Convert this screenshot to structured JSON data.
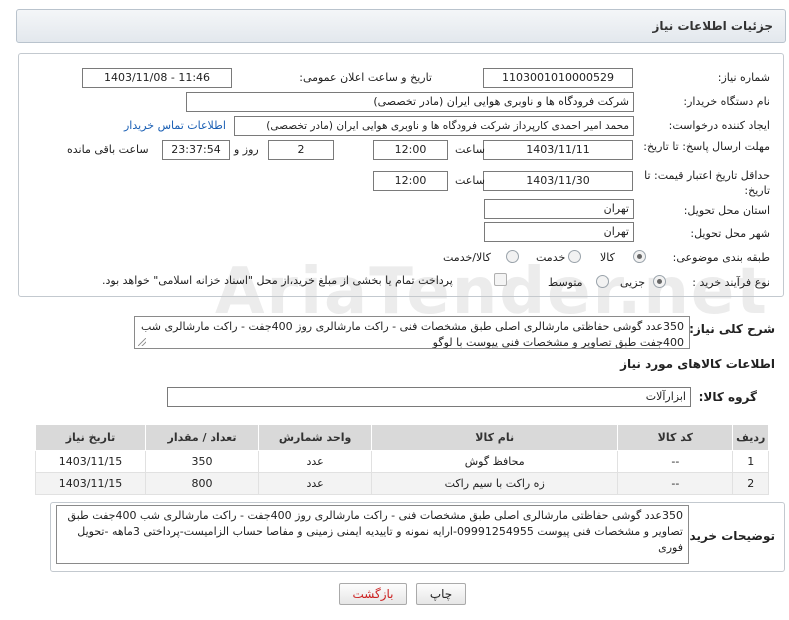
{
  "header": {
    "title": "جزئیات اطلاعات نیاز"
  },
  "fields": {
    "need_number_label": "شماره نیاز:",
    "need_number": "1103001010000529",
    "announce_label": "تاریخ و ساعت اعلان عمومی:",
    "announce_value": "1403/11/08 - 11:46",
    "buyer_org_label": "نام دستگاه خریدار:",
    "buyer_org": "شرکت فرودگاه ها و ناوبری هوایی ایران (مادر تخصصی)",
    "creator_label": "ایجاد کننده درخواست:",
    "creator": "محمد امیر احمدی کارپرداز شرکت فرودگاه ها و ناوبری هوایی ایران (مادر تخصصی)",
    "contact_link": "اطلاعات تماس خریدار",
    "deadline_label": "مهلت ارسال پاسخ: تا تاریخ:",
    "deadline_date": "1403/11/11",
    "time_word": "ساعت",
    "deadline_time": "12:00",
    "days_value": "2",
    "days_word": "روز و",
    "remaining_time": "23:37:54",
    "remaining_word": "ساعت باقی مانده",
    "validity_label": "حداقل تاریخ اعتبار قیمت: تا تاریخ:",
    "validity_date": "1403/11/30",
    "validity_time": "12:00",
    "province_label": "استان محل تحویل:",
    "province": "تهران",
    "city_label": "شهر محل تحویل:",
    "city": "تهران",
    "category_label": "طبقه بندی موضوعی:",
    "category_options": [
      "کالا",
      "خدمت",
      "کالا/خدمت"
    ],
    "process_label": "نوع فرآیند خرید :",
    "process_options": [
      "جزیی",
      "متوسط"
    ],
    "payment_note": "پرداخت تمام یا بخشی از مبلغ خرید،از محل \"اسناد خزانه اسلامی\" خواهد بود."
  },
  "description": {
    "label": "شرح کلی نیاز:",
    "text": "350عدد گوشی حفاظتی مارشالری اصلی طبق مشخصات فنی - راکت مارشالری روز 400جفت - راکت مارشالری شب 400جفت طبق تصاویر و مشخصات فنی پیوست با لوگو"
  },
  "goods_section": {
    "title": "اطلاعات کالاهای مورد نیاز",
    "group_label": "گروه کالا:",
    "group_value": "ابزارآلات"
  },
  "table": {
    "headers": [
      "ردیف",
      "کد کالا",
      "نام کالا",
      "واحد شمارش",
      "تعداد / مقدار",
      "تاریخ نیاز"
    ],
    "rows": [
      [
        "1",
        "--",
        "محافظ گوش",
        "عدد",
        "350",
        "1403/11/15"
      ],
      [
        "2",
        "--",
        "زه راکت با سیم راکت",
        "عدد",
        "800",
        "1403/11/15"
      ]
    ]
  },
  "buyer_notes": {
    "label": "توضیحات خریدار:",
    "text": "350عدد گوشی حفاظتی مارشالری اصلی طبق مشخصات فنی - راکت مارشالری روز 400جفت - راکت مارشالری شب 400جفت طبق تصاویر و مشخصات فنی پیوست 09991254955-ارایه نمونه و تاییدیه ایمنی زمینی و مفاصا حساب الزامیست-پرداختی 3ماهه -تحویل فوری"
  },
  "buttons": {
    "print": "چاپ",
    "back": "بازگشت"
  },
  "watermark": "AriaTender.net",
  "colors": {
    "link": "#1a5fb4",
    "back_text": "#cc2222",
    "table_header": "#d9d9d9"
  }
}
